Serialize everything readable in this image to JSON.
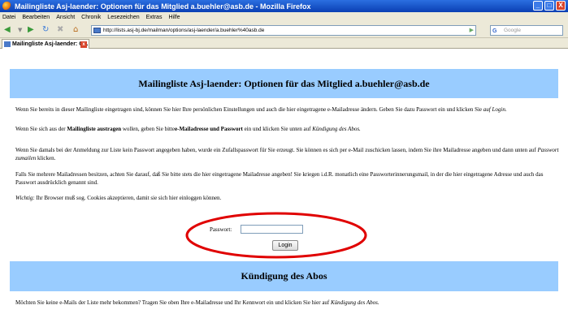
{
  "window": {
    "title": "Mailingliste Asj-laender: Optionen für das Mitglied a.buehler@asb.de - Mozilla Firefox",
    "controls": [
      "_",
      "□",
      "X"
    ]
  },
  "menu": [
    "Datei",
    "Bearbeiten",
    "Ansicht",
    "Chronik",
    "Lesezeichen",
    "Extras",
    "Hilfe"
  ],
  "toolbar": {
    "url": "http://lists.asj-bj.de/mailman/options/asj-laender/a.buehler%40asb.de",
    "search_placeholder": "Google",
    "search_engine_icon": "G"
  },
  "tab": {
    "label": "Mailingliste Asj-laender: O...",
    "close": "x"
  },
  "page": {
    "heading": "Mailingliste Asj-laender: Optionen für das Mitglied a.buehler@asb.de",
    "p1": {
      "text": "Wenn Sie bereits in dieser Mailingliste eingetragen sind, können Sie hier Ihre persönlichen Einstellungen und auch die hier eingetragene e-Mailadresse ändern. Geben Sie dazu Passwort ein und klicken Sie ",
      "em": "auf Login."
    },
    "p2": {
      "a": "Wenn Sie sich aus der ",
      "b1": "Mailingliste austragen",
      "c": " wollen, geben Sie bitte",
      "b2": "e-Mailadresse und Passwort",
      "d": " ein und klicken Sie unten auf ",
      "em": "Kündigung des Abos."
    },
    "p3": {
      "text": "Wenn Sie damals bei der Anmeldung zur Liste kein Passwort angegeben haben, wurde ein Zufallspasswort für Sie erzeugt. Sie können es sich per e-Mail zuschicken lassen, indem Sie ihre Mailadresse angeben und dann unten auf ",
      "em": "Passwort zumailen",
      "tail": " klicken."
    },
    "p4": "Falls Sie mehrere Mailadressen besitzen, achten Sie darauf, daß Sie bitte stets die hier eingetragene Mailadresse angeben! Sie kriegen i.d.R. monatlich eine Passworterinnerungsmail, in der die hier eingetragene Adresse und auch das Passwort ausdrücklich genannt sind.",
    "p5": {
      "em": "Wichtig:",
      "text": " Ihr Browser muß sog. Cookies akzeptieren, damit sie sich hier einloggen können."
    },
    "password_label": "Passwort:",
    "password_value": "",
    "login_button": "Login",
    "heading2": "Kündigung des Abos",
    "p6": {
      "text": "Möchten Sie keine e-Mails der Liste mehr bekommen? Tragen Sie oben Ihre e-Mailadresse und Ihr Kennwort ein und klicken Sie hier auf ",
      "em": "Kündigung des Abos."
    }
  },
  "colors": {
    "banner": "#99ccff",
    "annotation": "#e00000",
    "titlebar": "#0a3fb3"
  }
}
